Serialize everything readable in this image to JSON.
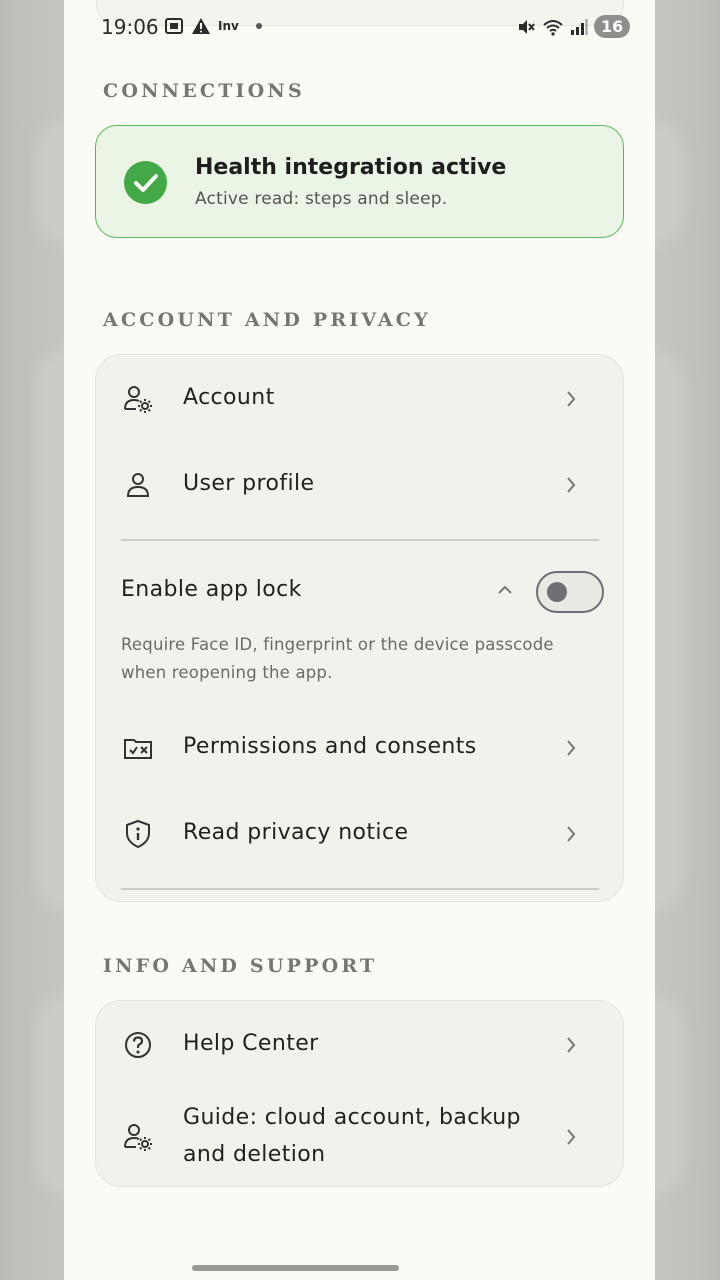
{
  "status_bar": {
    "time": "19:06",
    "app_badge": "Inv",
    "battery": "16"
  },
  "sections": {
    "connections": "CONNECTIONS",
    "account_privacy": "ACCOUNT AND PRIVACY",
    "info_support": "INFO AND SUPPORT"
  },
  "health": {
    "title": "Health integration active",
    "subtitle": "Active read: steps and sleep.",
    "icon": "check-circle-icon",
    "accent": "#43a946"
  },
  "account_privacy": {
    "account_label": "Account",
    "profile_label": "User profile",
    "app_lock_label": "Enable app lock",
    "app_lock_desc": "Require Face ID, fingerprint or the device passcode when reopening the app.",
    "app_lock_enabled": false,
    "permissions_label": "Permissions and consents",
    "privacy_label": "Read privacy notice"
  },
  "info_support": {
    "help_label": "Help Center",
    "guide_line1": "Guide: cloud account, backup",
    "guide_line2": "and deletion"
  }
}
